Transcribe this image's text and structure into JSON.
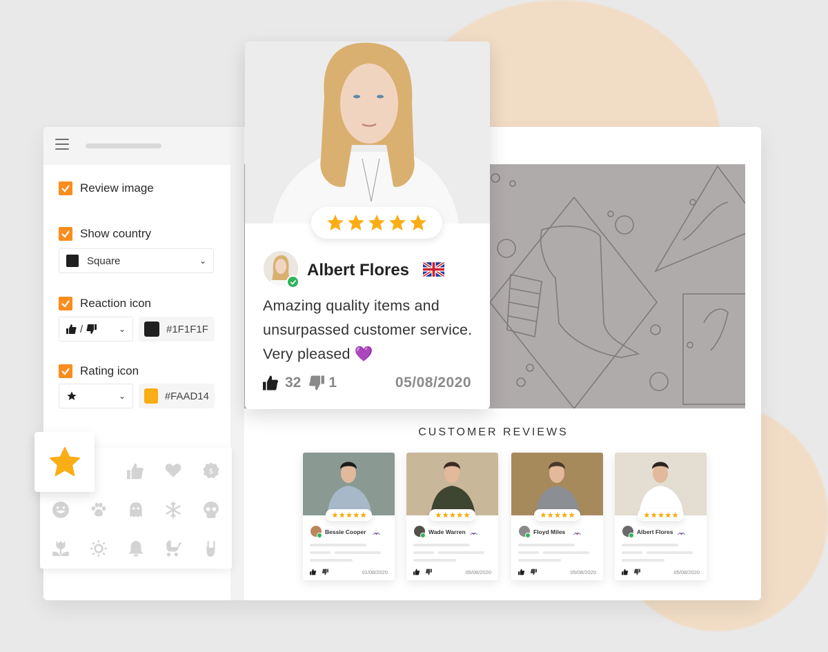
{
  "sidebar": {
    "options": [
      {
        "label": "Review image",
        "checked": true
      },
      {
        "label": "Show country",
        "checked": true
      },
      {
        "label": "Reaction icon",
        "checked": true
      },
      {
        "label": "Rating icon",
        "checked": true
      }
    ],
    "country_style": {
      "value": "Square",
      "swatch_color": "#1F1F1F"
    },
    "reaction_select": {
      "value": "thumbs-up / thumbs-down",
      "separator": "/"
    },
    "reaction_color": {
      "value": "#1F1F1F"
    },
    "rating_select": {
      "value": "star"
    },
    "rating_color": {
      "value": "#FAAD14"
    }
  },
  "icon_picker": {
    "selected": "star-icon",
    "icons": [
      "thumbs-up-icon",
      "heart-icon",
      "badge-dollar-icon",
      "smile-icon",
      "paw-icon",
      "ghost-icon",
      "snowflake-icon",
      "skull-icon",
      "tulip-icon",
      "sun-icon",
      "bell-icon",
      "stroller-icon",
      "rock-hand-icon"
    ]
  },
  "featured_review": {
    "rating": 5,
    "rating_max": 5,
    "name": "Albert Flores",
    "country": "UK",
    "verified": true,
    "text": "Amazing quality items and unsurpassed customer service. Very pleased 💜",
    "likes": "32",
    "dislikes": "1",
    "date": "05/08/2020"
  },
  "reviews_section": {
    "title": "CUSTOMER REVIEWS",
    "cards": [
      {
        "name": "Bessie Cooper",
        "rating": 5,
        "country": "UK",
        "date": "01/08/2020"
      },
      {
        "name": "Wade Warren",
        "rating": 5,
        "country": "UK",
        "date": "05/08/2020"
      },
      {
        "name": "Floyd Miles",
        "rating": 5,
        "country": "UK",
        "date": "05/08/2020"
      },
      {
        "name": "Albert Flores",
        "rating": 5,
        "country": "UK",
        "date": "05/08/2020"
      }
    ]
  },
  "colors": {
    "accent": "#FB8C1F",
    "rating": "#FAAD14",
    "reaction": "#1F1F1F",
    "verified": "#2FB45A",
    "banner": "#B0ABAB"
  }
}
